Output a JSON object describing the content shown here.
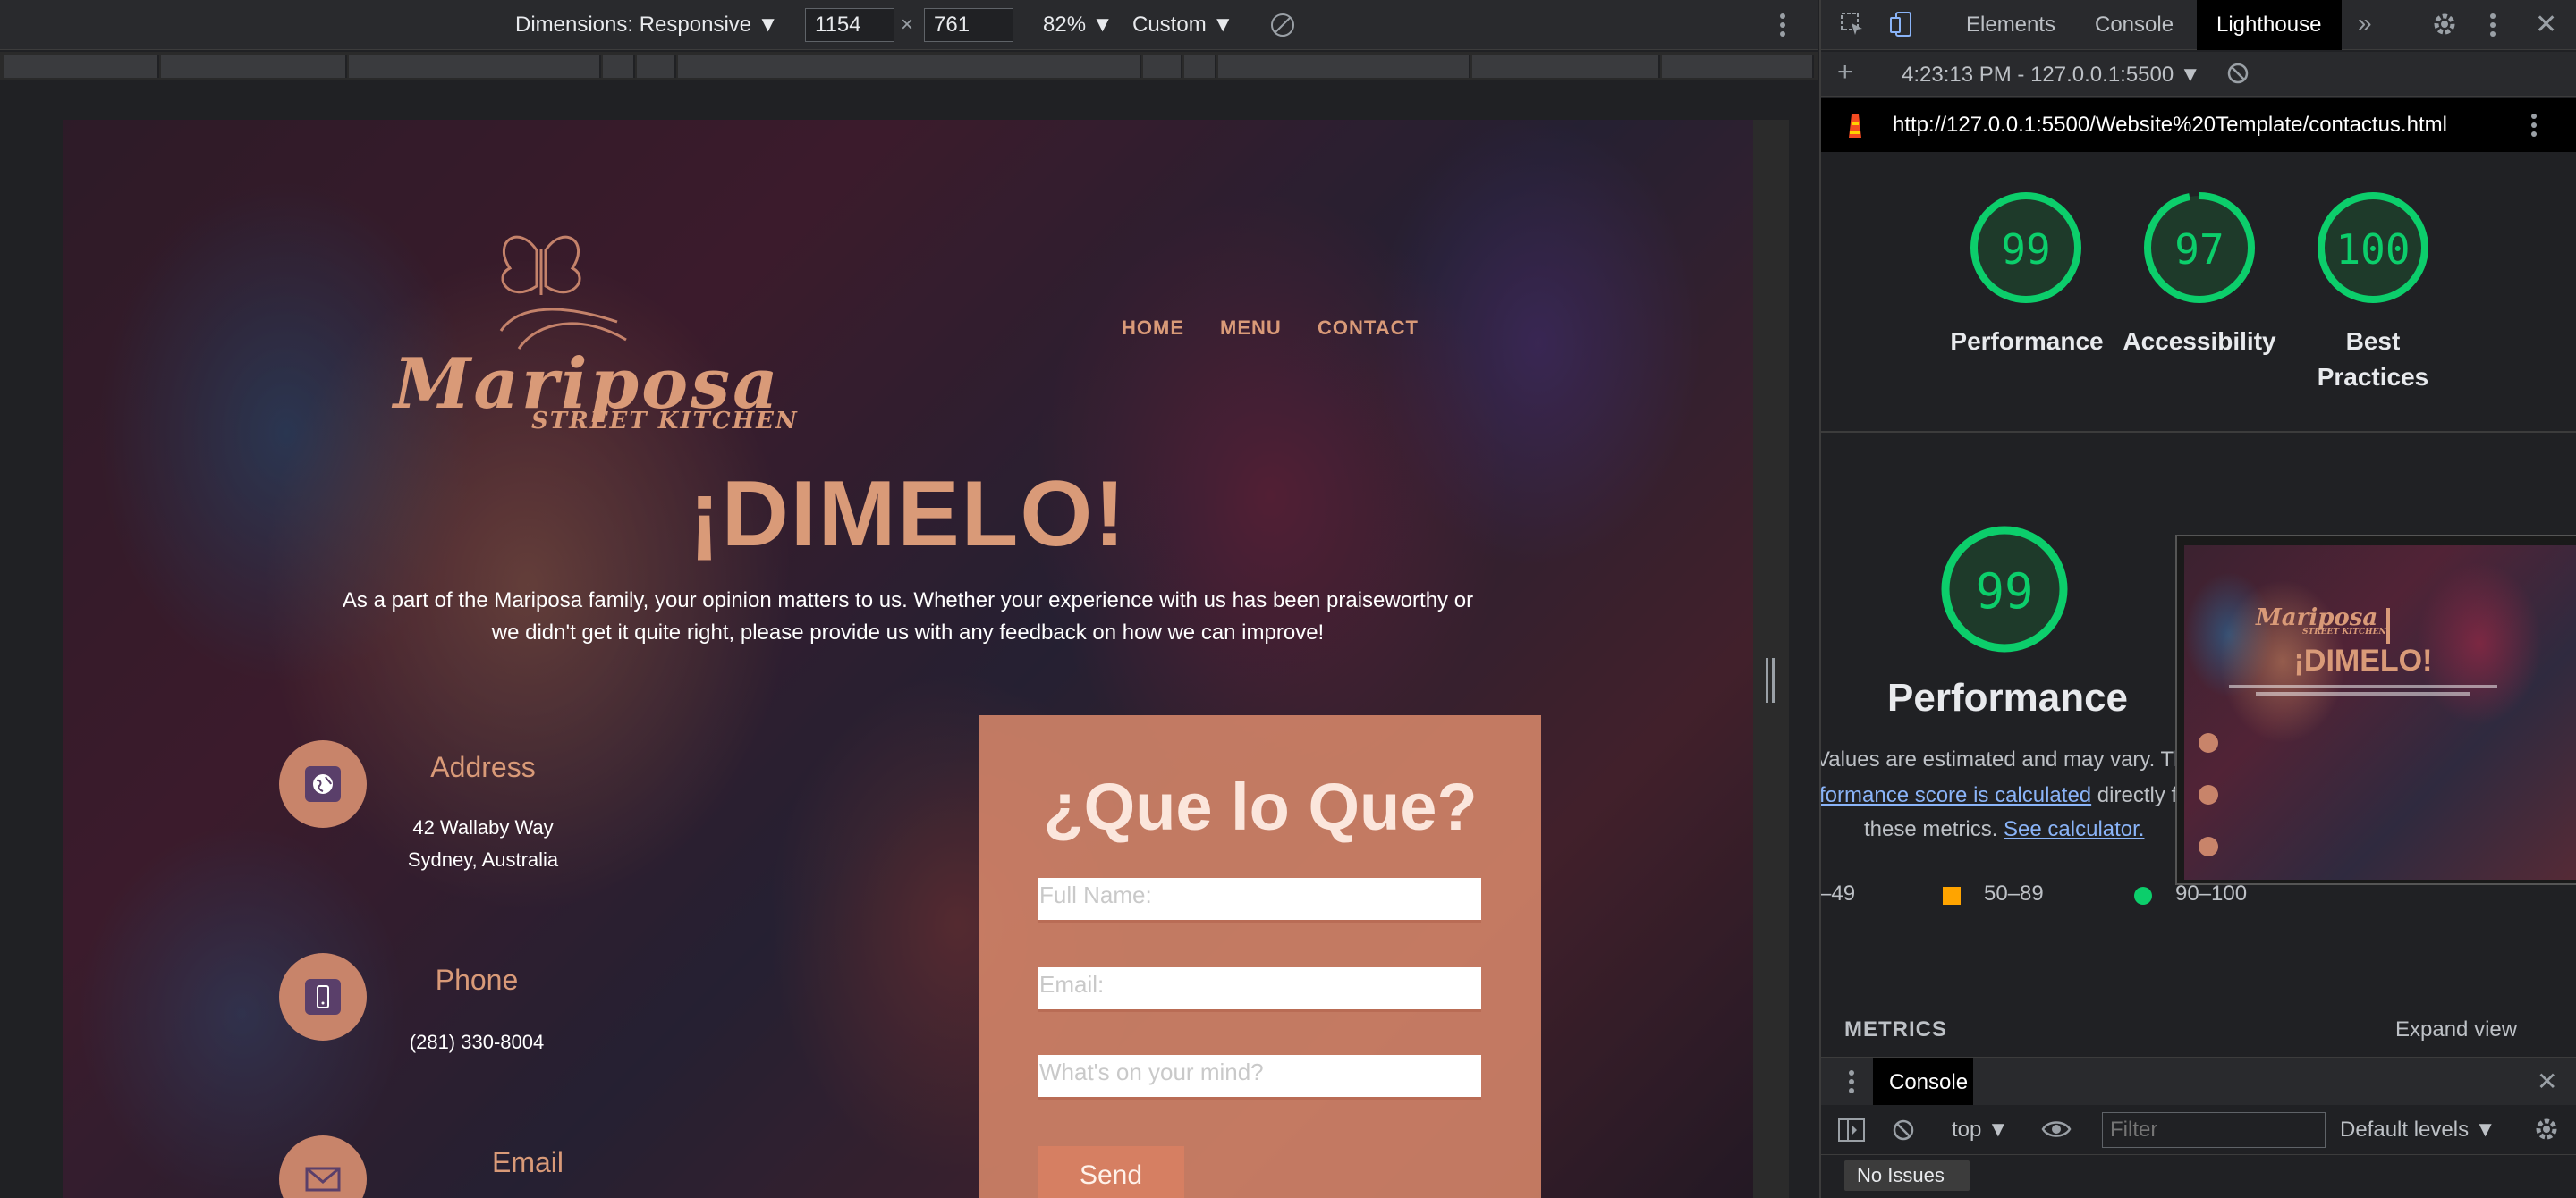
{
  "device_toolbar": {
    "dimensions_label": "Dimensions: Responsive ▼",
    "width": "1154",
    "times": "×",
    "height": "761",
    "zoom": "82% ▼",
    "throttle": "Custom ▼"
  },
  "site": {
    "nav": [
      "HOME",
      "MENU",
      "CONTACT"
    ],
    "logo_main": "Mariposa",
    "logo_sub": "STREET KITCHEN",
    "hero_title": "¡DIMELO!",
    "hero_text": "As a part of the Mariposa family, your opinion matters to us. Whether your experience with us has been praiseworthy or we didn't get it quite right, please provide us with any feedback on how we can improve!",
    "address": {
      "title": "Address",
      "line1": "42 Wallaby Way",
      "line2": "Sydney, Australia"
    },
    "phone": {
      "title": "Phone",
      "value": "(281) 330-8004"
    },
    "email": {
      "title": "Email"
    },
    "form": {
      "title": "¿Que lo Que?",
      "name_placeholder": "Full Name:",
      "email_placeholder": "Email:",
      "message_placeholder": "What's on your mind?",
      "send_label": "Send"
    }
  },
  "devtools": {
    "tabs": [
      "Elements",
      "Console",
      "Lighthouse"
    ],
    "report_time": "4:23:13 PM - 127.0.0.1:5500 ▼",
    "url": "http://127.0.0.1:5500/Website%20Template/contactus.html",
    "scores": [
      {
        "value": "99",
        "label": "Performance"
      },
      {
        "value": "97",
        "label": "Accessibility"
      },
      {
        "value": "100",
        "label": "Best Practices"
      }
    ],
    "perf_big": {
      "value": "99",
      "label": "Performance"
    },
    "estimate_text_1": "Values are estimated and may vary. Th",
    "estimate_link_1": "formance score is calculated",
    "estimate_text_2": " directly f",
    "estimate_text_3": "these metrics. ",
    "estimate_link_2": "See calculator.",
    "legend": [
      "–49",
      "50–89",
      "90–100"
    ],
    "metrics_label": "METRICS",
    "expand_label": "Expand view",
    "console_tab": "Console",
    "context": "top ▼",
    "filter_placeholder": "Filter",
    "levels": "Default levels ▼",
    "issues": "No Issues",
    "thumb": {
      "title": "¡DIMELO!",
      "logo": "Mariposa",
      "sub": "STREET KITCHEN"
    }
  },
  "colors": {
    "accent": "#d99a78",
    "score_green": "#0cce6b",
    "score_orange": "#ffa400"
  }
}
